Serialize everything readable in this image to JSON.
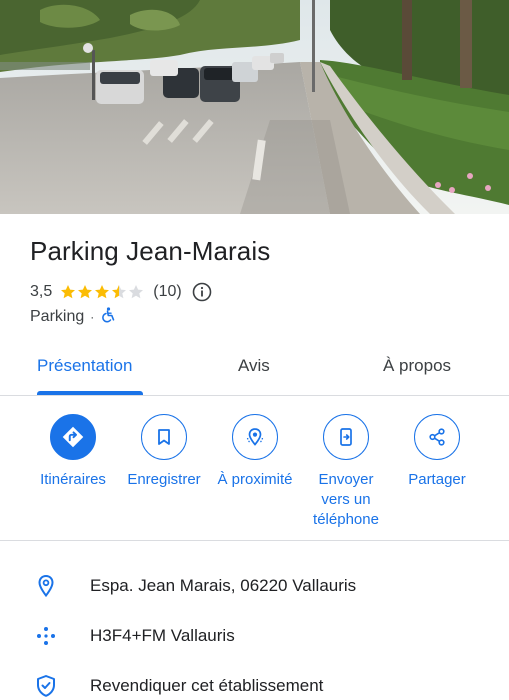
{
  "place": {
    "name": "Parking Jean-Marais",
    "rating": "3,5",
    "stars": 3.5,
    "review_count": "(10)",
    "category": "Parking",
    "category_separator": "·"
  },
  "tabs": [
    {
      "label": "Présentation",
      "active": true
    },
    {
      "label": "Avis",
      "active": false
    },
    {
      "label": "À propos",
      "active": false
    }
  ],
  "actions": [
    {
      "label": "Itinéraires",
      "icon": "directions-icon"
    },
    {
      "label": "Enregistrer",
      "icon": "bookmark-icon"
    },
    {
      "label": "À proximité",
      "icon": "nearby-icon"
    },
    {
      "label_lines": [
        "Envoyer",
        "vers un",
        "téléphone"
      ],
      "icon": "send-to-phone-icon"
    },
    {
      "label": "Partager",
      "icon": "share-icon"
    }
  ],
  "details": [
    {
      "text": "Espa. Jean Marais, 06220 Vallauris",
      "icon": "location-pin-icon"
    },
    {
      "text": "H3F4+FM Vallauris",
      "icon": "plus-code-icon"
    },
    {
      "text": "Revendiquer cet établissement",
      "icon": "verified-shield-icon"
    }
  ],
  "colors": {
    "accent": "#1a73e8",
    "star": "#fbbc04",
    "star_empty": "#dadce0",
    "text": "#202124",
    "divider": "#dadce0"
  }
}
